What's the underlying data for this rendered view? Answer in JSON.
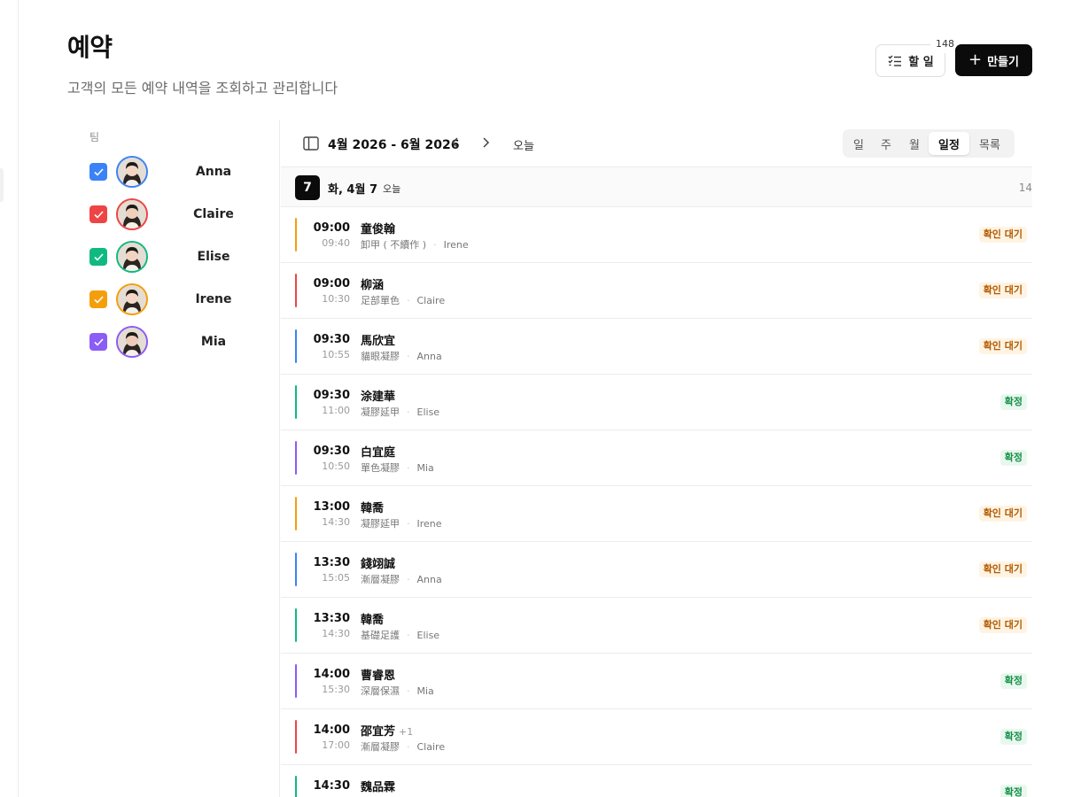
{
  "header": {
    "title": "예약",
    "subtitle": "고객의 모든 예약 내역을 조회하고 관리합니다"
  },
  "actions": {
    "todo_label": "할 일",
    "todo_count": "148",
    "create_label": "만들기"
  },
  "team": {
    "label": "팀",
    "members": [
      {
        "name": "Anna",
        "color": "#3b82f6",
        "checked": true
      },
      {
        "name": "Claire",
        "color": "#ef4444",
        "checked": true
      },
      {
        "name": "Elise",
        "color": "#10b981",
        "checked": true
      },
      {
        "name": "Irene",
        "color": "#f59e0b",
        "checked": true
      },
      {
        "name": "Mia",
        "color": "#8b5cf6",
        "checked": true
      }
    ]
  },
  "toolbar": {
    "range_label": "4월 2026 - 6월 2026",
    "prev_icon": "chevron-left-icon",
    "next_icon": "chevron-right-icon",
    "today_label": "오늘",
    "views": [
      "일",
      "주",
      "월",
      "일정",
      "목록"
    ],
    "active_view": "일정"
  },
  "day": {
    "number": "7",
    "label": "화, 4월 7",
    "today_tag": "오늘",
    "count": "14"
  },
  "appointments": [
    {
      "start": "09:00",
      "end": "09:40",
      "client": "童俊翰",
      "extra": "",
      "service": "卸甲 ( 不續作 )",
      "staff": "Irene",
      "status": "확인 대기",
      "status_type": "pending"
    },
    {
      "start": "09:00",
      "end": "10:30",
      "client": "柳涵",
      "extra": "",
      "service": "足部單色",
      "staff": "Claire",
      "status": "확인 대기",
      "status_type": "pending"
    },
    {
      "start": "09:30",
      "end": "10:55",
      "client": "馬欣宜",
      "extra": "",
      "service": "貓眼凝膠",
      "staff": "Anna",
      "status": "확인 대기",
      "status_type": "pending"
    },
    {
      "start": "09:30",
      "end": "11:00",
      "client": "涂建華",
      "extra": "",
      "service": "凝膠延甲",
      "staff": "Elise",
      "status": "확정",
      "status_type": "confirmed"
    },
    {
      "start": "09:30",
      "end": "10:50",
      "client": "白宜庭",
      "extra": "",
      "service": "單色凝膠",
      "staff": "Mia",
      "status": "확정",
      "status_type": "confirmed"
    },
    {
      "start": "13:00",
      "end": "14:30",
      "client": "韓喬",
      "extra": "",
      "service": "凝膠延甲",
      "staff": "Irene",
      "status": "확인 대기",
      "status_type": "pending"
    },
    {
      "start": "13:30",
      "end": "15:05",
      "client": "錢翊誠",
      "extra": "",
      "service": "漸層凝膠",
      "staff": "Anna",
      "status": "확인 대기",
      "status_type": "pending"
    },
    {
      "start": "13:30",
      "end": "14:30",
      "client": "韓喬",
      "extra": "",
      "service": "基礎足護",
      "staff": "Elise",
      "status": "확인 대기",
      "status_type": "pending"
    },
    {
      "start": "14:00",
      "end": "15:30",
      "client": "曹睿恩",
      "extra": "",
      "service": "深層保濕",
      "staff": "Mia",
      "status": "확정",
      "status_type": "confirmed"
    },
    {
      "start": "14:00",
      "end": "17:00",
      "client": "邵宜芳",
      "extra": "+1",
      "service": "漸層凝膠",
      "staff": "Claire",
      "status": "확정",
      "status_type": "confirmed"
    },
    {
      "start": "14:30",
      "end": "",
      "client": "魏品霖",
      "extra": "",
      "service": "",
      "staff": "",
      "status": "확정",
      "status_type": "confirmed"
    }
  ]
}
